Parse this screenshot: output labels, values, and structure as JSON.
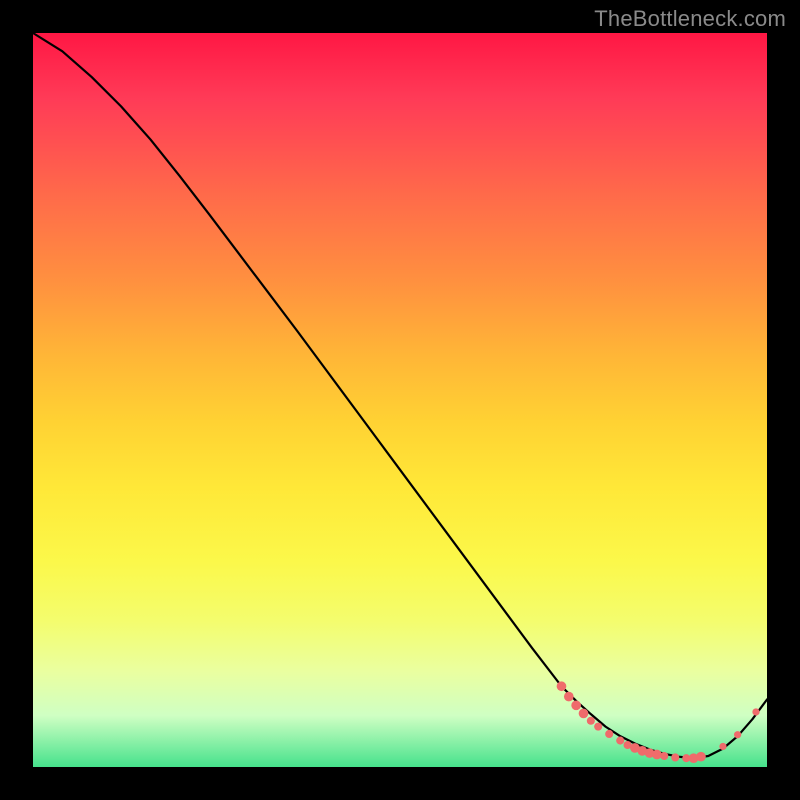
{
  "watermark": "TheBottleneck.com",
  "colors": {
    "curve": "#000000",
    "marker_fill": "#ef6b6b",
    "marker_stroke": "#c94f4f"
  },
  "chart_data": {
    "type": "line",
    "title": "",
    "xlabel": "",
    "ylabel": "",
    "xlim": [
      0,
      100
    ],
    "ylim": [
      0,
      100
    ],
    "grid": false,
    "legend": false,
    "series": [
      {
        "name": "curve",
        "x": [
          0,
          4,
          8,
          12,
          16,
          20,
          24,
          28,
          32,
          36,
          40,
          44,
          48,
          52,
          56,
          60,
          64,
          68,
          72,
          74,
          76,
          78,
          80,
          82,
          84,
          86,
          88,
          90,
          92,
          94,
          96,
          98,
          100
        ],
        "y": [
          100,
          97.5,
          94,
          90,
          85.5,
          80.5,
          75.3,
          70,
          64.7,
          59.4,
          54,
          48.6,
          43.2,
          37.8,
          32.4,
          27,
          21.6,
          16.2,
          11,
          9,
          7.2,
          5.5,
          4.2,
          3.2,
          2.4,
          1.8,
          1.4,
          1.2,
          1.5,
          2.5,
          4.2,
          6.5,
          9.2
        ]
      }
    ],
    "markers": [
      {
        "x": 72.0,
        "y": 11.0,
        "r": 1.2
      },
      {
        "x": 73.0,
        "y": 9.6,
        "r": 1.2
      },
      {
        "x": 74.0,
        "y": 8.4,
        "r": 1.2
      },
      {
        "x": 75.0,
        "y": 7.3,
        "r": 1.2
      },
      {
        "x": 76.0,
        "y": 6.3,
        "r": 1.0
      },
      {
        "x": 77.0,
        "y": 5.5,
        "r": 1.0
      },
      {
        "x": 78.5,
        "y": 4.5,
        "r": 1.0
      },
      {
        "x": 80.0,
        "y": 3.6,
        "r": 1.0
      },
      {
        "x": 81.0,
        "y": 3.0,
        "r": 1.0
      },
      {
        "x": 82.0,
        "y": 2.6,
        "r": 1.2
      },
      {
        "x": 83.0,
        "y": 2.2,
        "r": 1.2
      },
      {
        "x": 84.0,
        "y": 1.9,
        "r": 1.2
      },
      {
        "x": 85.0,
        "y": 1.7,
        "r": 1.2
      },
      {
        "x": 86.0,
        "y": 1.5,
        "r": 1.0
      },
      {
        "x": 87.5,
        "y": 1.3,
        "r": 1.0
      },
      {
        "x": 89.0,
        "y": 1.2,
        "r": 1.0
      },
      {
        "x": 90.0,
        "y": 1.2,
        "r": 1.2
      },
      {
        "x": 91.0,
        "y": 1.4,
        "r": 1.2
      },
      {
        "x": 94.0,
        "y": 2.8,
        "r": 0.9
      },
      {
        "x": 96.0,
        "y": 4.4,
        "r": 0.9
      },
      {
        "x": 98.5,
        "y": 7.5,
        "r": 0.9
      }
    ]
  }
}
